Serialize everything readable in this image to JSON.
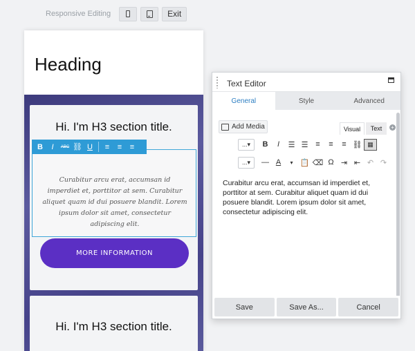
{
  "responsive_bar": {
    "label": "Responsive Editing",
    "phone_icon": "phone-icon",
    "tablet_icon": "tablet-icon",
    "exit_label": "Exit"
  },
  "preview": {
    "heading": "Heading",
    "card1": {
      "title": "Hi. I'm H3 section title.",
      "body": "Curabitur arcu erat, accumsan id imperdiet et, porttitor at sem. Curabitur aliquet quam id dui posuere blandit. Lorem ipsum dolor sit amet, consectetur adipiscing elit.",
      "button_label": "MORE INFORMATION"
    },
    "card2": {
      "title": "Hi. I'm H3 section title."
    },
    "inline_toolbar": {
      "bold": "B",
      "italic": "I",
      "strike": "ABC",
      "link": "⛓",
      "underline": "U",
      "align_left": "≡",
      "align_center": "≡",
      "align_right": "≡"
    }
  },
  "panel": {
    "title": "Text Editor",
    "tabs": [
      "General",
      "Style",
      "Advanced"
    ],
    "active_tab": "General",
    "add_media_label": "Add Media",
    "view_tabs": [
      "Visual",
      "Text"
    ],
    "toolbar_row1": {
      "format_select": "...",
      "bold": "B",
      "italic": "I",
      "bullets": "☰",
      "numbers": "☰",
      "align_left": "≡",
      "align_center": "≡",
      "align_right": "≡",
      "link": "⛓",
      "kitchen_sink": "▦"
    },
    "toolbar_row2": {
      "format_select": "...",
      "hr": "—",
      "text_color": "A",
      "paste": "📋",
      "clear": "⌫",
      "omega": "Ω",
      "indent": "⇥",
      "outdent": "⇤",
      "undo": "↶",
      "redo": "↷"
    },
    "content": "Curabitur arcu erat, accumsan id imperdiet et, porttitor at sem. Curabitur aliquet quam id dui posuere blandit. Lorem ipsum dolor sit amet, consectetur adipiscing elit.",
    "footer": {
      "save": "Save",
      "save_as": "Save As...",
      "cancel": "Cancel"
    }
  },
  "colors": {
    "accent_blue": "#2e9bd6",
    "button_purple": "#5b2fc4",
    "active_tab_text": "#2c7ec2"
  }
}
